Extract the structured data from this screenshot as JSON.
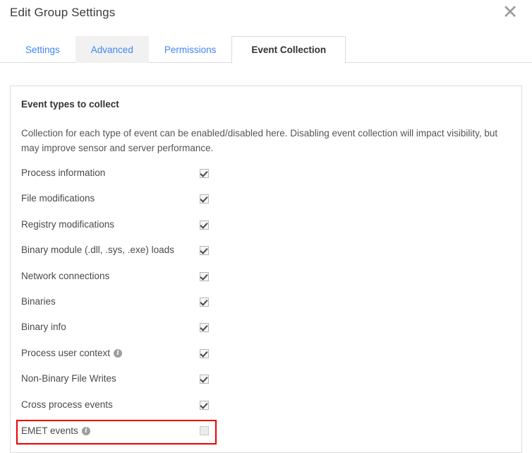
{
  "dialog": {
    "title": "Edit Group Settings",
    "close_label": "✕",
    "close_icon": "close-icon"
  },
  "tabs": [
    {
      "label": "Settings",
      "state": "normal"
    },
    {
      "label": "Advanced",
      "state": "hovered"
    },
    {
      "label": "Permissions",
      "state": "normal"
    },
    {
      "label": "Event Collection",
      "state": "active"
    }
  ],
  "panel": {
    "section_title": "Event types to collect",
    "section_description": "Collection for each type of event can be enabled/disabled here. Disabling event collection will impact visibility, but may improve sensor and server performance."
  },
  "event_types": [
    {
      "label": "Process information",
      "checked": true,
      "info": false,
      "highlighted": false
    },
    {
      "label": "File modifications",
      "checked": true,
      "info": false,
      "highlighted": false
    },
    {
      "label": "Registry modifications",
      "checked": true,
      "info": false,
      "highlighted": false
    },
    {
      "label": "Binary module (.dll, .sys, .exe) loads",
      "checked": true,
      "info": false,
      "highlighted": false
    },
    {
      "label": "Network connections",
      "checked": true,
      "info": false,
      "highlighted": false
    },
    {
      "label": "Binaries",
      "checked": true,
      "info": false,
      "highlighted": false
    },
    {
      "label": "Binary info",
      "checked": true,
      "info": false,
      "highlighted": false
    },
    {
      "label": "Process user context",
      "checked": true,
      "info": true,
      "highlighted": false
    },
    {
      "label": "Non-Binary File Writes",
      "checked": true,
      "info": false,
      "highlighted": false
    },
    {
      "label": "Cross process events",
      "checked": true,
      "info": false,
      "highlighted": false
    },
    {
      "label": "EMET events",
      "checked": false,
      "info": true,
      "highlighted": true
    }
  ],
  "info_icon_glyph": "i",
  "colors": {
    "tab_link": "#4285f4",
    "highlight": "#ee0000",
    "panel_border": "#dddddd",
    "text": "#4a4a4a"
  }
}
